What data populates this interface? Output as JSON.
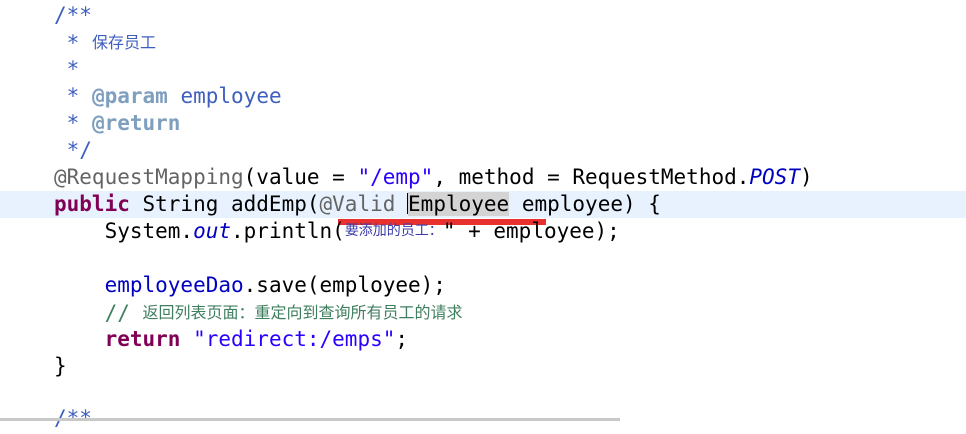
{
  "editor": {
    "javadoc": {
      "open": "/**",
      "star": " *",
      "summary": "保存员工",
      "param_tag": "@param",
      "param_name": "employee",
      "return_tag": "@return",
      "close": " */"
    },
    "mapping": {
      "annotation": "@RequestMapping",
      "open_args": "(value = ",
      "value": "\"/emp\"",
      "method_part": ", method = RequestMethod.",
      "method_const": "POST",
      "close_args": ")"
    },
    "signature": {
      "kw_public": "public",
      "return_type": " String addEmp(",
      "valid_annotation": "@Valid",
      "param_type": "Employee",
      "param_rest": " employee) {"
    },
    "println": {
      "prefix": "    System.",
      "out_field": "out",
      "call": ".println(",
      "string_fragment": "要添加的员工：",
      "suffix": "\" + employee);"
    },
    "save": {
      "indent": "    ",
      "dao_field": "employeeDao",
      "call": ".save(employee);"
    },
    "comment": {
      "slashes": "    // ",
      "text": "返回列表页面：重定向到查询所有员工的请求"
    },
    "return_stmt": {
      "indent": "    ",
      "kw_return": "return",
      "string": "\"redirect:/emps\"",
      "end": ";"
    },
    "close_brace": "}",
    "next_doc": "/**"
  }
}
